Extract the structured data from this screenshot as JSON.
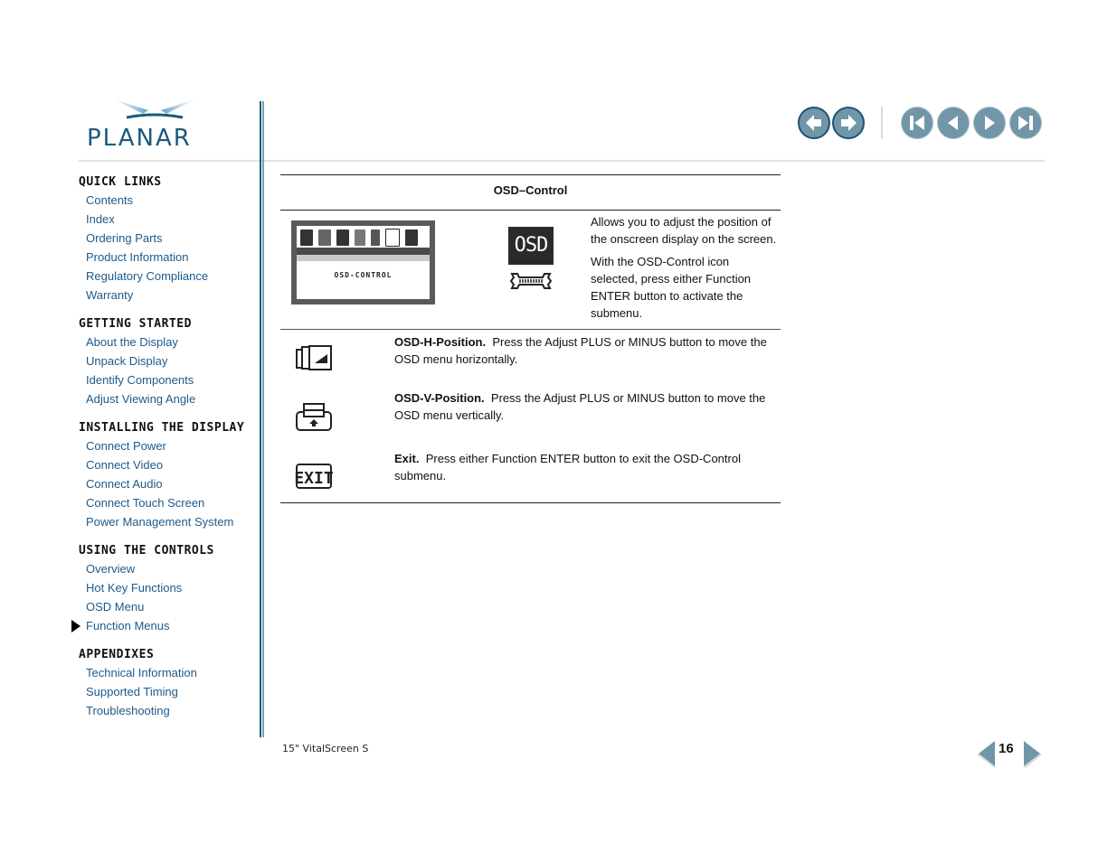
{
  "logo": {
    "text": "PLANAR"
  },
  "toolbar": {
    "history_back": "history-back",
    "history_forward": "history-forward",
    "first_page": "first-page",
    "prev_page": "previous-page",
    "next_page": "next-page",
    "last_page": "last-page"
  },
  "sidebar": {
    "sections": [
      {
        "title": "QUICK LINKS",
        "items": [
          "Contents",
          "Index",
          "Ordering Parts",
          "Product Information",
          "Regulatory Compliance",
          "Warranty"
        ]
      },
      {
        "title": "GETTING STARTED",
        "items": [
          "About the Display",
          "Unpack Display",
          "Identify Components",
          "Adjust Viewing Angle"
        ]
      },
      {
        "title": "INSTALLING THE DISPLAY",
        "items": [
          "Connect Power",
          "Connect Video",
          "Connect Audio",
          "Connect Touch Screen",
          "Power Management System"
        ]
      },
      {
        "title": "USING THE CONTROLS",
        "items": [
          "Overview",
          "Hot Key Functions",
          "OSD Menu",
          "Function Menus"
        ]
      },
      {
        "title": "APPENDIXES",
        "items": [
          "Technical Information",
          "Supported Timing",
          "Troubleshooting"
        ]
      }
    ],
    "current_item": "Function Menus"
  },
  "table": {
    "title": "OSD–Control",
    "osd_screen_caption": "OSD-CONTROL",
    "osd_icon_label": "OSD",
    "intro": {
      "p1": "Allows you to adjust the position of the onscreen display on the screen.",
      "p2": "With the OSD-Control icon selected, press either Function ENTER button to activate the submenu."
    },
    "rows": [
      {
        "icon": "osd-h-position-icon",
        "term": "OSD-H-Position.",
        "text": "Press the Adjust PLUS or MINUS button to move the OSD menu horizontally."
      },
      {
        "icon": "osd-v-position-icon",
        "term": "OSD-V-Position.",
        "text": "Press the Adjust PLUS or MINUS button to move the OSD menu vertically."
      },
      {
        "icon": "exit-icon",
        "term": "Exit.",
        "text": "Press either Function ENTER button to exit the OSD-Control submenu."
      }
    ]
  },
  "footer": {
    "product": "15\" VitalScreen S",
    "page_number": "16"
  }
}
